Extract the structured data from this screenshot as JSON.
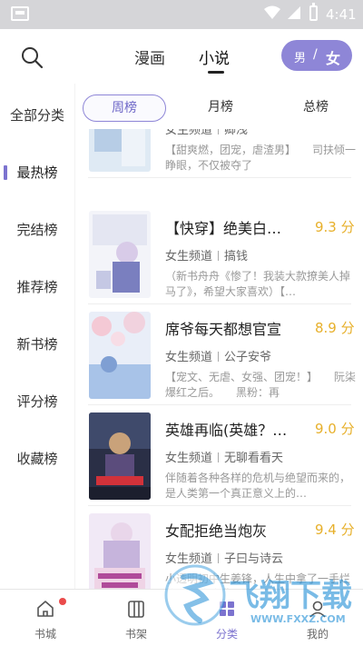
{
  "status_bar": {
    "time": "4:41"
  },
  "top_tabs": [
    {
      "label": "漫画",
      "active": false
    },
    {
      "label": "小说",
      "active": true
    }
  ],
  "gender_toggle": {
    "male": "男",
    "separator": "/",
    "female": "女"
  },
  "sidebar": {
    "items": [
      {
        "label": "全部分类",
        "active": false
      },
      {
        "label": "最热榜",
        "active": true
      },
      {
        "label": "完结榜",
        "active": false
      },
      {
        "label": "推荐榜",
        "active": false
      },
      {
        "label": "新书榜",
        "active": false
      },
      {
        "label": "评分榜",
        "active": false
      },
      {
        "label": "收藏榜",
        "active": false
      }
    ]
  },
  "sub_tabs": [
    {
      "label": "周榜",
      "active": true
    },
    {
      "label": "月榜",
      "active": false
    },
    {
      "label": "总榜",
      "active": false
    }
  ],
  "books": [
    {
      "title": "",
      "score": "",
      "channel": "女生频道",
      "author": "卿浅",
      "desc": "【甜爽燃，团宠，虐渣男】　　司扶倾一睁眼，不仅被夺了"
    },
    {
      "title": "【快穿】绝美白…",
      "score": "9.3 分",
      "channel": "女生频道",
      "author": "搞钱",
      "desc": "（新书舟舟《惨了！我装大款撩美人掉马了》，希望大家喜欢）【…"
    },
    {
      "title": "席爷每天都想官宣",
      "score": "8.9 分",
      "channel": "女生频道",
      "author": "公子安爷",
      "desc": "【宠文、无虐、女强、团宠！】　　阮柒爆红之后。　　黑粉：再"
    },
    {
      "title": "英雄再临(英雄？…",
      "score": "9.0 分",
      "channel": "女生频道",
      "author": "无聊看看天",
      "desc": "伴随着各种各样的危机与绝望而来的，是人类第一个真正意义上的…"
    },
    {
      "title": "女配拒绝当炮灰",
      "score": "9.4 分",
      "channel": "女生频道",
      "author": "子曰与诗云",
      "desc": "小透明初中生姜锋，人生中拿了一手烂牌，亲爹冷漠，"
    }
  ],
  "bottom_nav": [
    {
      "label": "书城",
      "icon": "home-icon",
      "badge": true,
      "active": false
    },
    {
      "label": "书架",
      "icon": "bookshelf-icon",
      "badge": false,
      "active": false
    },
    {
      "label": "分类",
      "icon": "category-icon",
      "badge": false,
      "active": true
    },
    {
      "label": "我的",
      "icon": "profile-icon",
      "badge": false,
      "active": false
    }
  ],
  "watermark": {
    "text": "飞翔下载",
    "url": "WWW.FXXZ.COM"
  },
  "colors": {
    "accent": "#8e86d7",
    "score": "#e7b02b",
    "badge": "#ea4b4b"
  }
}
